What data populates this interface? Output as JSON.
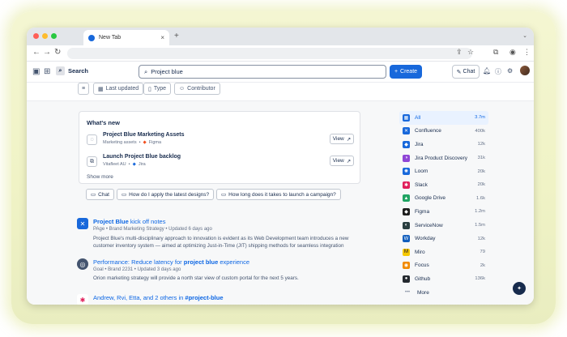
{
  "browser": {
    "tab_title": "New Tab",
    "close_symbol": "×",
    "new_tab_symbol": "+",
    "tab_menu_symbol": "⌄",
    "back_symbol": "←",
    "forward_symbol": "→",
    "reload_symbol": "↻"
  },
  "header": {
    "search_label": "Search",
    "search_value": "Project blue",
    "create_label": "Create",
    "chat_label": "Chat"
  },
  "filters": {
    "last_updated": "Last updated",
    "type": "Type",
    "contributor": "Contributor"
  },
  "whats_new": {
    "title": "What's new",
    "items": [
      {
        "title": "Project Blue Marketing Assets",
        "context": "Marketing assets",
        "source": "Figma",
        "view": "View"
      },
      {
        "title": "Launch Project Blue backlog",
        "context": "Vitafleet AU",
        "source": "Jira",
        "view": "View"
      }
    ],
    "show_more": "Show more"
  },
  "quick_actions": [
    {
      "label": "Chat"
    },
    {
      "label": "How do I apply the latest designs?"
    },
    {
      "label": "How long does it takes to launch a campaign?"
    }
  ],
  "results": [
    {
      "title_bold": "Project Blue",
      "title_rest": " kick off notes",
      "meta": "PAge • Brand Marketing Strategy • Updated 6 days ago",
      "description": "Project Blue's multi-disciplinary approach to innovation is evident as its Web Development team introduces a new customer inventory system — aimed at optimizing Just-in-Time (JIT) shipping methods for seamless integration"
    },
    {
      "title_pre": "Performance: Reduce latency for ",
      "title_bold": "project blue",
      "title_post": " experience",
      "meta": "Goal • Brand 2231 • Updated 3 days ago",
      "description": "Orion marketing strategy will provide a north star view of custom portal for the next 5 years."
    },
    {
      "title_pre": "Andrew, Rvi, Etta, and 2 others in ",
      "title_bold": "#project-blue"
    }
  ],
  "sources": [
    {
      "name": "All",
      "count": "3.7m",
      "icon": "grid-icon",
      "color": "#1868db"
    },
    {
      "name": "Confluence",
      "count": "400k",
      "icon": "confluence-icon",
      "color": "#1868db"
    },
    {
      "name": "Jira",
      "count": "12k",
      "icon": "jira-icon",
      "color": "#1868db"
    },
    {
      "name": "Jira Product Discovery",
      "count": "31k",
      "icon": "jpd-icon",
      "color": "#8f46d6"
    },
    {
      "name": "Loom",
      "count": "20k",
      "icon": "loom-icon",
      "color": "#1868db"
    },
    {
      "name": "Slack",
      "count": "20k",
      "icon": "slack-icon",
      "color": "#e01e5a"
    },
    {
      "name": "Google Drive",
      "count": "1.6k",
      "icon": "google-drive-icon",
      "color": "#1fa463"
    },
    {
      "name": "Figma",
      "count": "1.2m",
      "icon": "figma-icon",
      "color": "#1e1e1e"
    },
    {
      "name": "ServiceNow",
      "count": "1.5m",
      "icon": "servicenow-icon",
      "color": "#293e40"
    },
    {
      "name": "Workday",
      "count": "12k",
      "icon": "workday-icon",
      "color": "#0f5dbd"
    },
    {
      "name": "Miro",
      "count": "79",
      "icon": "miro-icon",
      "color": "#f5c800"
    },
    {
      "name": "Focus",
      "count": "2k",
      "icon": "focus-icon",
      "color": "#f18a00"
    },
    {
      "name": "Github",
      "count": "136k",
      "icon": "github-icon",
      "color": "#24292f"
    },
    {
      "name": "More",
      "count": "",
      "icon": "more-icon",
      "color": "#8590a2"
    }
  ],
  "colors": {
    "brand_blue": "#1868db",
    "link_blue": "#0c66e4",
    "selected_bg": "#e9f2ff",
    "glow": "#f0f3c6"
  }
}
